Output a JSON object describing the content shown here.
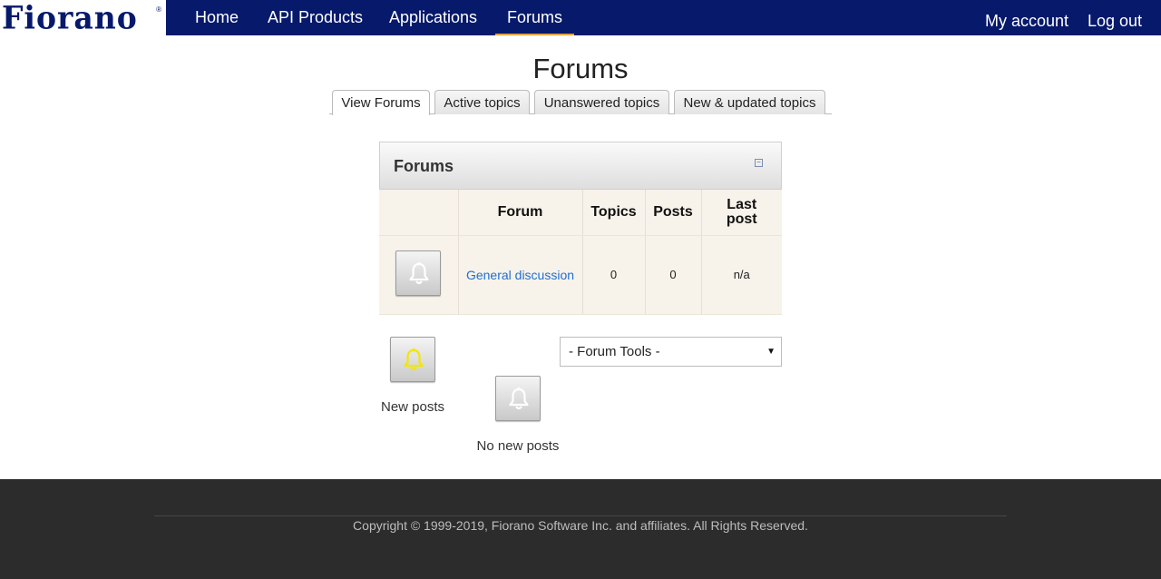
{
  "brand": {
    "logo_text": "Fiorano",
    "reg_mark": "®"
  },
  "nav": {
    "items": [
      {
        "label": "Home"
      },
      {
        "label": "API Products"
      },
      {
        "label": "Applications"
      },
      {
        "label": "Forums"
      }
    ],
    "right": [
      {
        "label": "My account"
      },
      {
        "label": "Log out"
      }
    ],
    "active_accent": "#e8a33d"
  },
  "page": {
    "title": "Forums",
    "tabs": [
      {
        "label": "View Forums"
      },
      {
        "label": "Active topics"
      },
      {
        "label": "Unanswered topics"
      },
      {
        "label": "New & updated topics"
      }
    ]
  },
  "panel": {
    "title": "Forums",
    "collapse_glyph": "−",
    "columns": [
      "Forum",
      "Topics",
      "Posts",
      "Last post"
    ],
    "rows": [
      {
        "icon": "bell-icon",
        "forum": "General discussion",
        "topics": "0",
        "posts": "0",
        "last_post": "n/a"
      }
    ]
  },
  "legend": {
    "new_posts": "New posts",
    "no_new_posts": "No new posts"
  },
  "forum_tools": {
    "selected": "- Forum Tools -"
  },
  "footer": {
    "copyright": "Copyright © 1999-2019, Fiorano Software Inc. and affiliates. All Rights Reserved."
  },
  "colors": {
    "nav_bg": "#06196b",
    "link": "#1f6fd1",
    "footer_bg": "#2c2c2c",
    "bell_new": "#f2e600",
    "bell_none": "#ffffff"
  }
}
